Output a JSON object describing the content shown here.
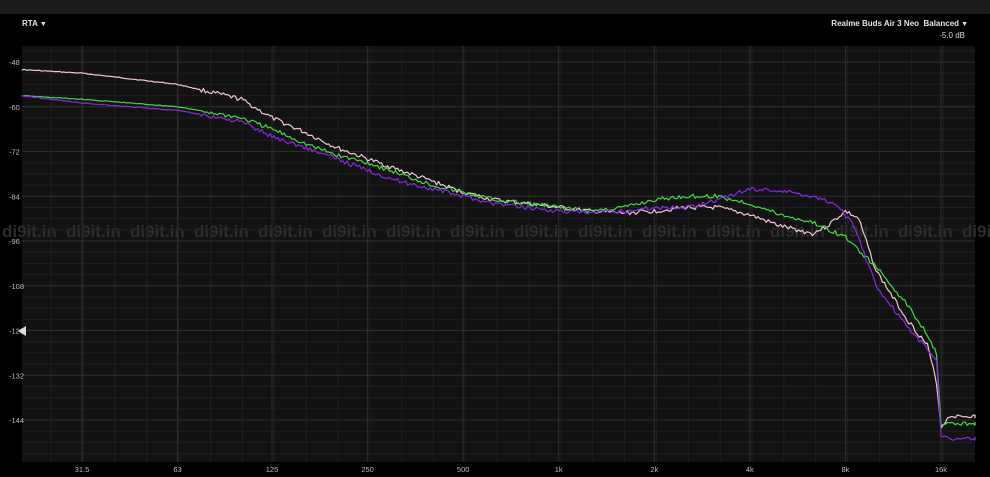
{
  "header": {
    "mode_label": "RTA",
    "device_label": "Realme Buds Air 3 Neo",
    "preset_label": "Balanced",
    "offset_label": "-5.0 dB"
  },
  "watermark": "di9it.in",
  "colors": {
    "background": "#121212",
    "grid": "#2e2e2e",
    "green": "#3fdc3f",
    "pink": "#f2c6d2",
    "purple": "#8a26e6"
  },
  "chart_data": {
    "type": "line",
    "title": "",
    "xlabel": "",
    "ylabel": "",
    "x_scale": "log",
    "xlim": [
      20,
      24000
    ],
    "ylim": [
      -155,
      -42
    ],
    "x_ticks": [
      {
        "value": 31.5,
        "label": "31.5"
      },
      {
        "value": 63,
        "label": "63"
      },
      {
        "value": 125,
        "label": "125"
      },
      {
        "value": 250,
        "label": "250"
      },
      {
        "value": 500,
        "label": "500"
      },
      {
        "value": 1000,
        "label": "1k"
      },
      {
        "value": 2000,
        "label": "2k"
      },
      {
        "value": 4000,
        "label": "4k"
      },
      {
        "value": 8000,
        "label": "8k"
      },
      {
        "value": 16000,
        "label": "16k"
      }
    ],
    "y_ticks": [
      -48,
      -60,
      -72,
      -84,
      -96,
      -108,
      -120,
      -132,
      -144
    ],
    "grid": true,
    "series": [
      {
        "color": "#f2c6d2",
        "x": [
          20,
          31.5,
          63,
          100,
          125,
          160,
          200,
          250,
          315,
          400,
          500,
          630,
          800,
          1000,
          1250,
          1600,
          2000,
          2500,
          3150,
          4000,
          5000,
          6300,
          7000,
          8000,
          8800,
          10000,
          12500,
          14500,
          15500,
          16000,
          17000,
          24000
        ],
        "y": [
          -50,
          -51,
          -54,
          -58,
          -63,
          -67,
          -71,
          -74,
          -77,
          -80,
          -83,
          -85,
          -86,
          -87,
          -88,
          -88.5,
          -88,
          -87,
          -87,
          -89,
          -92,
          -94,
          -92,
          -88,
          -90,
          -104,
          -117,
          -124,
          -134,
          -146,
          -143,
          -143
        ]
      },
      {
        "color": "#3fdc3f",
        "x": [
          20,
          31.5,
          63,
          100,
          125,
          160,
          200,
          250,
          315,
          400,
          500,
          630,
          800,
          1000,
          1250,
          1600,
          2000,
          2500,
          3150,
          4000,
          5000,
          6300,
          8000,
          10000,
          12500,
          14500,
          15500,
          16000,
          17000,
          24000
        ],
        "y": [
          -57,
          -58,
          -60,
          -63,
          -66,
          -70,
          -73,
          -75,
          -78,
          -81,
          -83,
          -85,
          -86,
          -87,
          -88,
          -87,
          -85,
          -84,
          -84,
          -86,
          -89,
          -91,
          -95,
          -103,
          -113,
          -121,
          -126,
          -145,
          -145,
          -145
        ]
      },
      {
        "color": "#8a26e6",
        "x": [
          20,
          31.5,
          63,
          100,
          125,
          160,
          200,
          250,
          315,
          400,
          500,
          630,
          800,
          1000,
          1250,
          1600,
          2000,
          2500,
          3150,
          4000,
          5000,
          6300,
          7500,
          8500,
          10000,
          12500,
          14500,
          15500,
          16000,
          17000,
          24000
        ],
        "y": [
          -57,
          -59,
          -61,
          -64,
          -68,
          -71,
          -74,
          -77,
          -80,
          -82,
          -84,
          -86,
          -87,
          -88,
          -88.5,
          -88,
          -87,
          -87,
          -85,
          -82,
          -82.5,
          -84,
          -86,
          -92,
          -108,
          -119,
          -125,
          -128,
          -148,
          -149,
          -149
        ]
      }
    ]
  }
}
